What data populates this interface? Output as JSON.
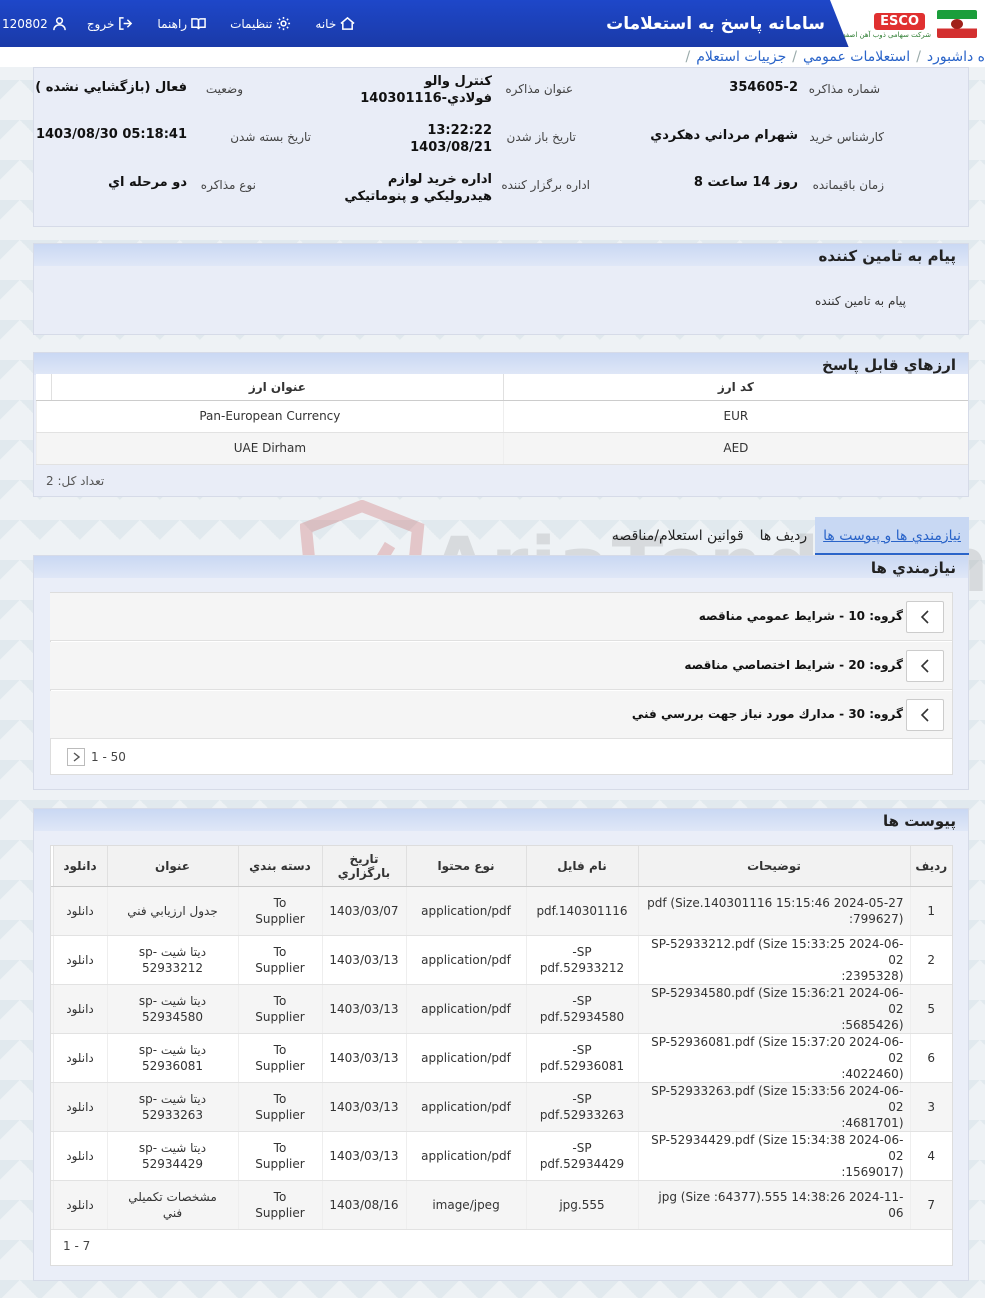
{
  "header": {
    "title": "سامانه پاسخ به استعلامات",
    "logo_text": "ESCO",
    "logo_subtitle": "شرکت سهامی ذوب آهن اصفهان",
    "nav": {
      "user_id": "120802",
      "logout": "خروج",
      "help": "راهنما",
      "settings": "تنظيمات",
      "home": "خانه"
    }
  },
  "breadcrumb": {
    "items": [
      "ه داشبورد",
      "استعلامات عمومي",
      "جزييات استعلام"
    ]
  },
  "info": {
    "number_label": "شماره مذاکره",
    "number": "354605-2",
    "subject_label": "عنوان مذاکره",
    "subject_line1": "کنترل والو",
    "subject_line2": "فولادي-140301116",
    "status_label": "وضعيت",
    "status": "فعال (بازگشايي نشده )",
    "expert_label": "کارشناس خريد",
    "expert": "شهرام مرداني دهکردي",
    "open_label": "تاريخ باز شدن",
    "open_time": "13:22:22",
    "open_date": "1403/08/21",
    "close_label": "تاريخ بسته شدن",
    "close": "1403/08/30 05:18:41",
    "remaining_label": "زمان باقيمانده",
    "remaining": "8 روز 14 ساعت",
    "org_label": "اداره برگزار کننده",
    "org_line1": "اداره خريد لوازم",
    "org_line2": "هيدروليکي و پنوماتيکي",
    "type_label": "نوع مذاکره",
    "type": "دو مرحله اي"
  },
  "message": {
    "title": "پيام به تامين کننده",
    "body": "پيام به تامين کننده"
  },
  "currencies": {
    "title": "ارزهاي قابل پاسخ",
    "headers": {
      "code": "کد ارز",
      "name": "عنوان ارز"
    },
    "rows": [
      {
        "code": "EUR",
        "name": "Pan-European Currency"
      },
      {
        "code": "AED",
        "name": "UAE Dirham"
      }
    ],
    "total": "تعداد کل: 2"
  },
  "tabs": [
    {
      "label": "نيازمندي ها و پيوست ها"
    },
    {
      "label": "رديف ها"
    },
    {
      "label": "قوانين استعلام/مناقصه"
    }
  ],
  "requirements": {
    "title": "نيازمندي ها",
    "groups": [
      {
        "label": "گروه: 10 - شرايط عمومي مناقصه"
      },
      {
        "label": "گروه: 20 - شرايط اختصاصي مناقصه"
      },
      {
        "label": "گروه: 30 - مدارك مورد نياز جهت بررسي فني"
      }
    ],
    "pager": "1 - 50"
  },
  "watermark": "AriaTender.neT",
  "attachments": {
    "title": "پيوست ها",
    "headers": {
      "row": "رديف",
      "desc": "توضيحات",
      "file": "نام فايل",
      "content": "نوع محتوا",
      "date": "تاريخ بارگزاري",
      "category": "دسته بندي",
      "name": "عنوان",
      "download": "دانلود"
    },
    "rows": [
      {
        "row": "1",
        "desc1": "pdf (Size.140301116 15:15:46 2024-05-27",
        "desc2": ":799627)",
        "file1": "pdf.140301116",
        "file2": "",
        "content": "application/pdf",
        "date": "1403/03/07",
        "cat1": "To",
        "cat2": "Supplier",
        "name1": "جدول ارزيابي فني",
        "name2": "",
        "download": "دانلود"
      },
      {
        "row": "2",
        "desc1": "SP-52933212.pdf (Size 15:33:25 2024-06-02",
        "desc2": ":2395328)",
        "file1": "SP-",
        "file2": "52933212.pdf",
        "content": "application/pdf",
        "date": "1403/03/13",
        "cat1": "To",
        "cat2": "Supplier",
        "name1": "ديتا شيت -sp",
        "name2": "52933212",
        "download": "دانلود"
      },
      {
        "row": "5",
        "desc1": "SP-52934580.pdf (Size 15:36:21 2024-06-02",
        "desc2": ":5685426)",
        "file1": "SP-",
        "file2": "52934580.pdf",
        "content": "application/pdf",
        "date": "1403/03/13",
        "cat1": "To",
        "cat2": "Supplier",
        "name1": "ديتا شيت -sp",
        "name2": "52934580",
        "download": "دانلود"
      },
      {
        "row": "6",
        "desc1": "SP-52936081.pdf (Size 15:37:20 2024-06-02",
        "desc2": ":4022460)",
        "file1": "SP-",
        "file2": "52936081.pdf",
        "content": "application/pdf",
        "date": "1403/03/13",
        "cat1": "To",
        "cat2": "Supplier",
        "name1": "ديتا شيت -sp",
        "name2": "52936081",
        "download": "دانلود"
      },
      {
        "row": "3",
        "desc1": "SP-52933263.pdf (Size 15:33:56 2024-06-02",
        "desc2": ":4681701)",
        "file1": "SP-",
        "file2": "52933263.pdf",
        "content": "application/pdf",
        "date": "1403/03/13",
        "cat1": "To",
        "cat2": "Supplier",
        "name1": "ديتا شيت -sp",
        "name2": "52933263",
        "download": "دانلود"
      },
      {
        "row": "4",
        "desc1": "SP-52934429.pdf (Size 15:34:38 2024-06-02",
        "desc2": ":1569017)",
        "file1": "SP-",
        "file2": "52934429.pdf",
        "content": "application/pdf",
        "date": "1403/03/13",
        "cat1": "To",
        "cat2": "Supplier",
        "name1": "ديتا شيت -sp",
        "name2": "52934429",
        "download": "دانلود"
      },
      {
        "row": "7",
        "desc1": "jpg (Size :64377).555 14:38:26 2024-11-06",
        "desc2": "",
        "file1": "jpg.555",
        "file2": "",
        "content": "image/jpeg",
        "date": "1403/08/16",
        "cat1": "To",
        "cat2": "Supplier",
        "name1": "مشخصات تكميلي",
        "name2": "فني",
        "download": "دانلود"
      }
    ],
    "pager": "1 - 7"
  }
}
